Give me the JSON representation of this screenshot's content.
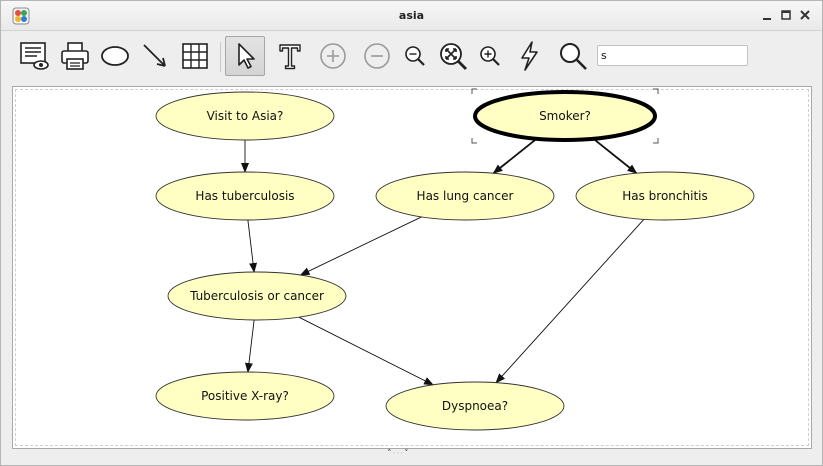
{
  "window": {
    "title": "asia",
    "controls": [
      "minimize",
      "maximize",
      "close"
    ]
  },
  "toolbar": {
    "search_value": "s",
    "tools": [
      {
        "name": "preview-icon"
      },
      {
        "name": "print-icon"
      },
      {
        "name": "ellipse-node-icon"
      },
      {
        "name": "arc-arrow-icon"
      },
      {
        "name": "table-icon"
      },
      {
        "name": "select-pointer-icon",
        "pressed": true
      },
      {
        "name": "text-tool-icon"
      },
      {
        "name": "zoom-in-circle-icon"
      },
      {
        "name": "zoom-out-circle-icon"
      },
      {
        "name": "zoom-out-magnifier-icon"
      },
      {
        "name": "zoom-fit-icon"
      },
      {
        "name": "zoom-in-magnifier-icon"
      },
      {
        "name": "lightning-icon"
      },
      {
        "name": "search-icon"
      }
    ]
  },
  "graph": {
    "node_fill": "#ffffc4",
    "node_stroke": "#333333",
    "selected_node": "smoker",
    "nodes": [
      {
        "id": "visit",
        "label": "Visit to Asia?"
      },
      {
        "id": "smoker",
        "label": "Smoker?"
      },
      {
        "id": "tub",
        "label": "Has tuberculosis"
      },
      {
        "id": "lung",
        "label": "Has lung cancer"
      },
      {
        "id": "bronc",
        "label": "Has bronchitis"
      },
      {
        "id": "either",
        "label": "Tuberculosis or cancer"
      },
      {
        "id": "xray",
        "label": "Positive X-ray?"
      },
      {
        "id": "dysp",
        "label": "Dyspnoea?"
      }
    ],
    "edges": [
      {
        "from": "visit",
        "to": "tub"
      },
      {
        "from": "smoker",
        "to": "lung"
      },
      {
        "from": "smoker",
        "to": "bronc"
      },
      {
        "from": "tub",
        "to": "either"
      },
      {
        "from": "lung",
        "to": "either"
      },
      {
        "from": "either",
        "to": "xray"
      },
      {
        "from": "either",
        "to": "dysp"
      },
      {
        "from": "bronc",
        "to": "dysp"
      }
    ]
  }
}
